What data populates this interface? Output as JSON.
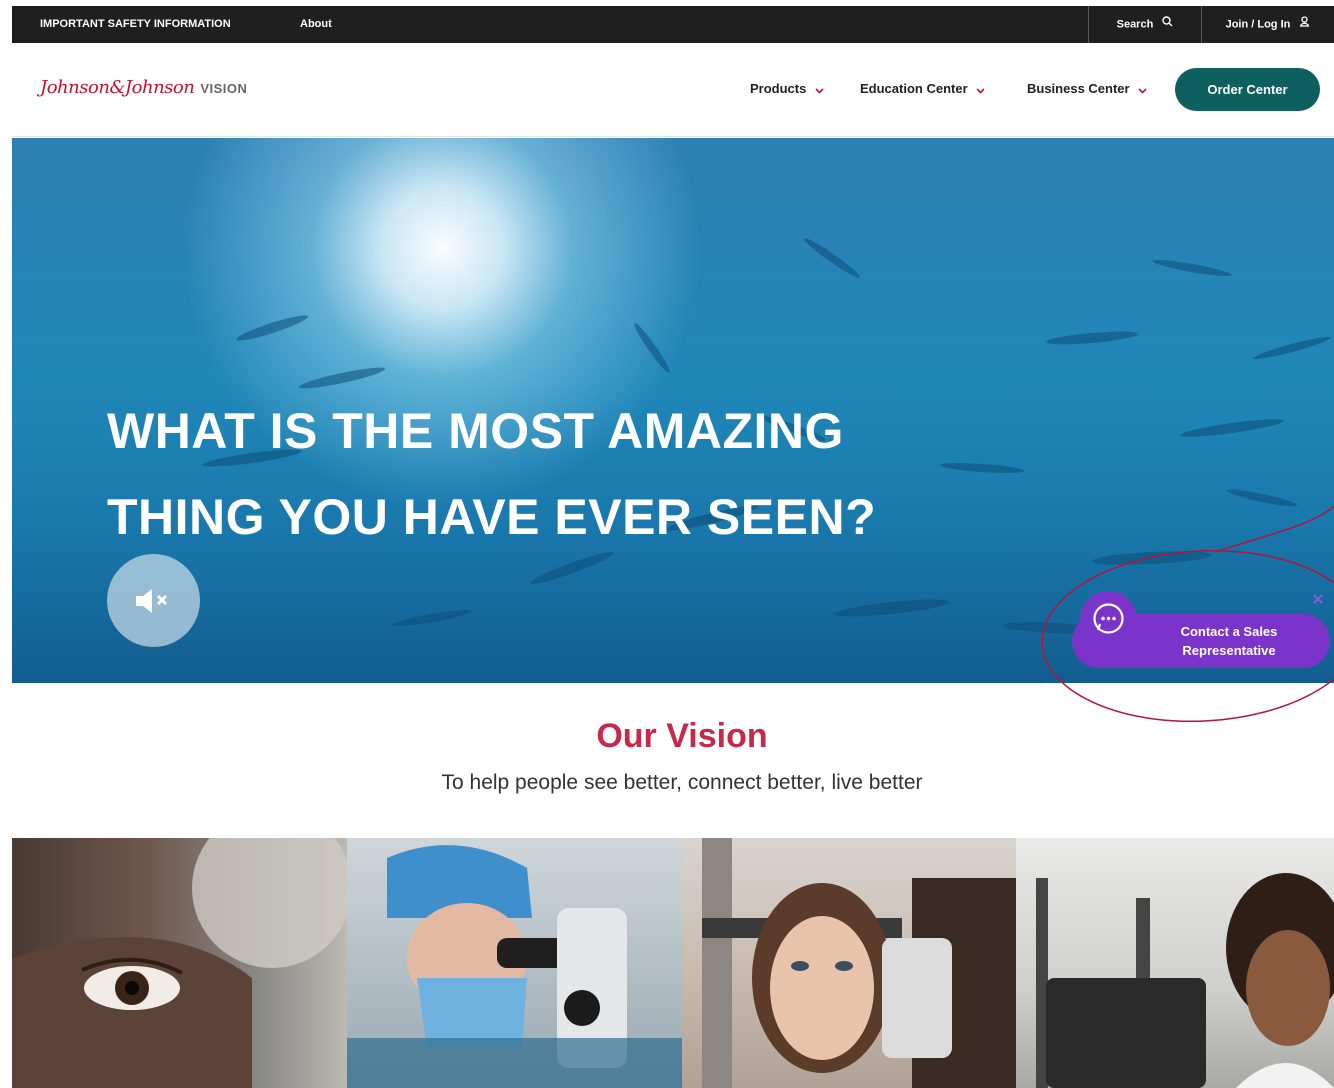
{
  "utility_bar": {
    "safety_label": "IMPORTANT SAFETY INFORMATION",
    "about_label": "About",
    "search_label": "Search",
    "join_label": "Join / Log In"
  },
  "brand": {
    "script": "Johnson&Johnson",
    "suffix": "VISION",
    "color": "#c8102e"
  },
  "nav": {
    "items": [
      {
        "label": "Products"
      },
      {
        "label": "Education Center"
      },
      {
        "label": "Business Center"
      }
    ],
    "order_button": "Order Center",
    "accent": "#0e5f5f",
    "chevron_color": "#c8102e"
  },
  "hero": {
    "title_line1": "WHAT IS THE MOST AMAZING",
    "title_line2": "THING YOU HAVE EVER SEEN?",
    "mute_icon": "speaker-muted-icon"
  },
  "chat": {
    "label_line1": "Contact a Sales",
    "label_line2": "Representative",
    "color": "#7b34c9"
  },
  "vision": {
    "title": "Our Vision",
    "subtitle": "To help people see better, connect better, live better",
    "title_color": "#c8284a"
  }
}
